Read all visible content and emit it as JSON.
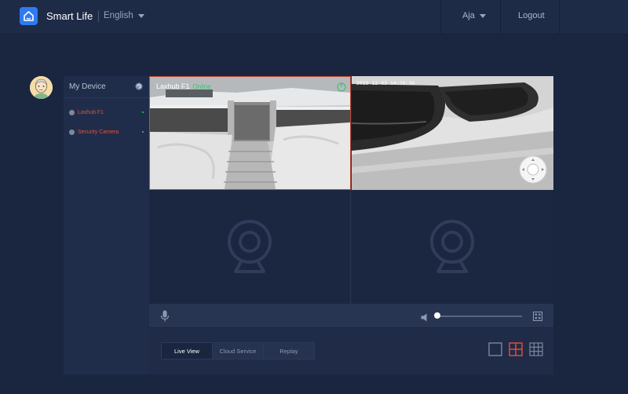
{
  "header": {
    "app_title": "Smart Life",
    "language": "English",
    "user": "Aja",
    "logout": "Logout"
  },
  "colors": {
    "accent": "#2e7bf1",
    "active_red": "#e5503a",
    "online_green": "#3ec46d"
  },
  "sidebar": {
    "title": "My Device",
    "devices": [
      {
        "name": "Laxhub F1"
      },
      {
        "name": "Security Camera"
      }
    ]
  },
  "viewer": {
    "cam1_label": "Laxhub F1",
    "cam1_status": "Online",
    "cam2_timestamp": "2023-12-03 14:28:36",
    "volume": 0.02
  },
  "tabs": [
    {
      "label": "Live View",
      "active": true
    },
    {
      "label": "Cloud Service",
      "active": false
    },
    {
      "label": "Replay",
      "active": false
    }
  ],
  "icons": [
    "home-icon",
    "refresh-icon",
    "mic-icon",
    "speaker-icon",
    "fullscreen-icon",
    "ptz-control-icon",
    "camera-placeholder-icon",
    "layout-1x1-icon",
    "layout-2x2-icon",
    "layout-3x3-icon"
  ]
}
